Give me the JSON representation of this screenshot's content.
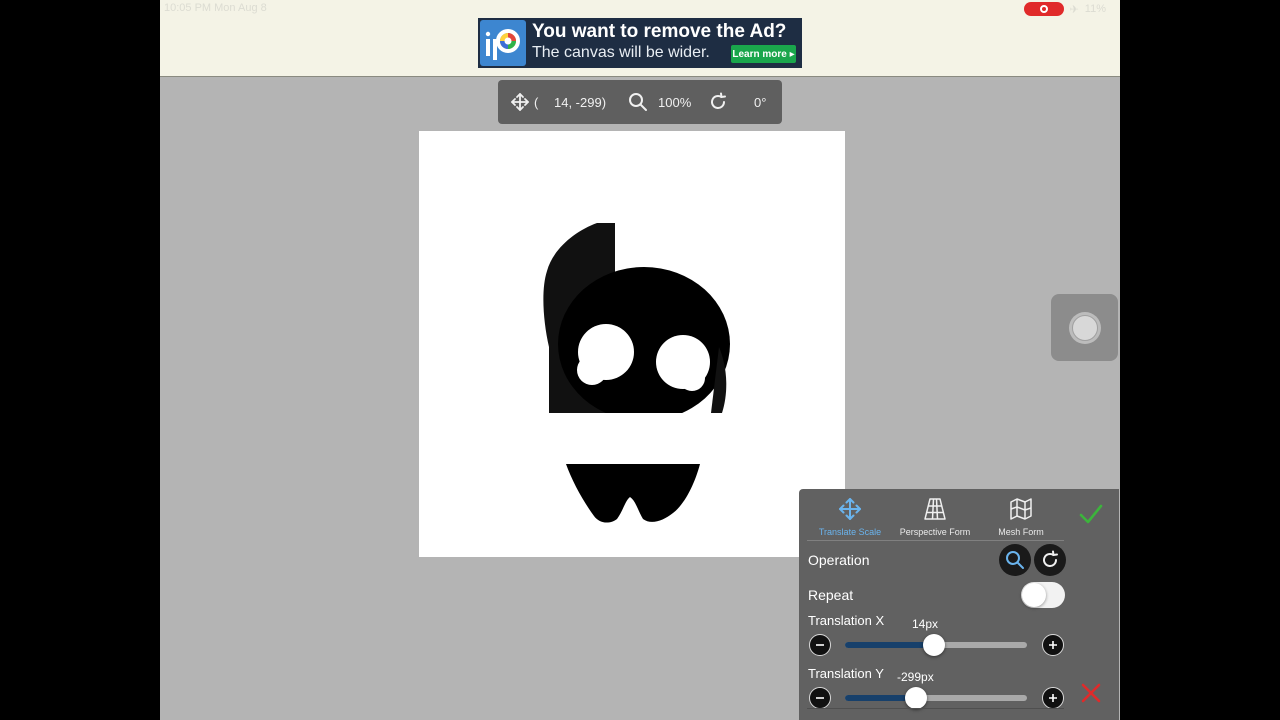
{
  "status_bar": {
    "time": "10:05 PM  Mon Aug 8",
    "battery": "11%"
  },
  "ad": {
    "title": "You want to remove the Ad?",
    "subtitle": "The canvas will be wider.",
    "cta": "Learn more ▸"
  },
  "transform_info": {
    "paren": "(",
    "coords": "14,  -299)",
    "zoom": "100%",
    "angle": "0°"
  },
  "panel": {
    "tools": [
      {
        "label": "Translate Scale",
        "icon": "move-icon",
        "active": true
      },
      {
        "label": "Perspective Form",
        "icon": "perspective-grid-icon",
        "active": false
      },
      {
        "label": "Mesh Form",
        "icon": "mesh-map-icon",
        "active": false
      }
    ],
    "operation_label": "Operation",
    "repeat_label": "Repeat",
    "repeat_on": false,
    "translation_x": {
      "label": "Translation X",
      "value_text": "14px",
      "level": 0.49
    },
    "translation_y": {
      "label": "Translation Y",
      "value_text": "-299px",
      "level": 0.39
    }
  },
  "colors": {
    "accent_blue": "#6ab4ee",
    "confirm_green": "#3cb43c",
    "cancel_red": "#e02a2a",
    "slider_fill": "#17406b"
  }
}
